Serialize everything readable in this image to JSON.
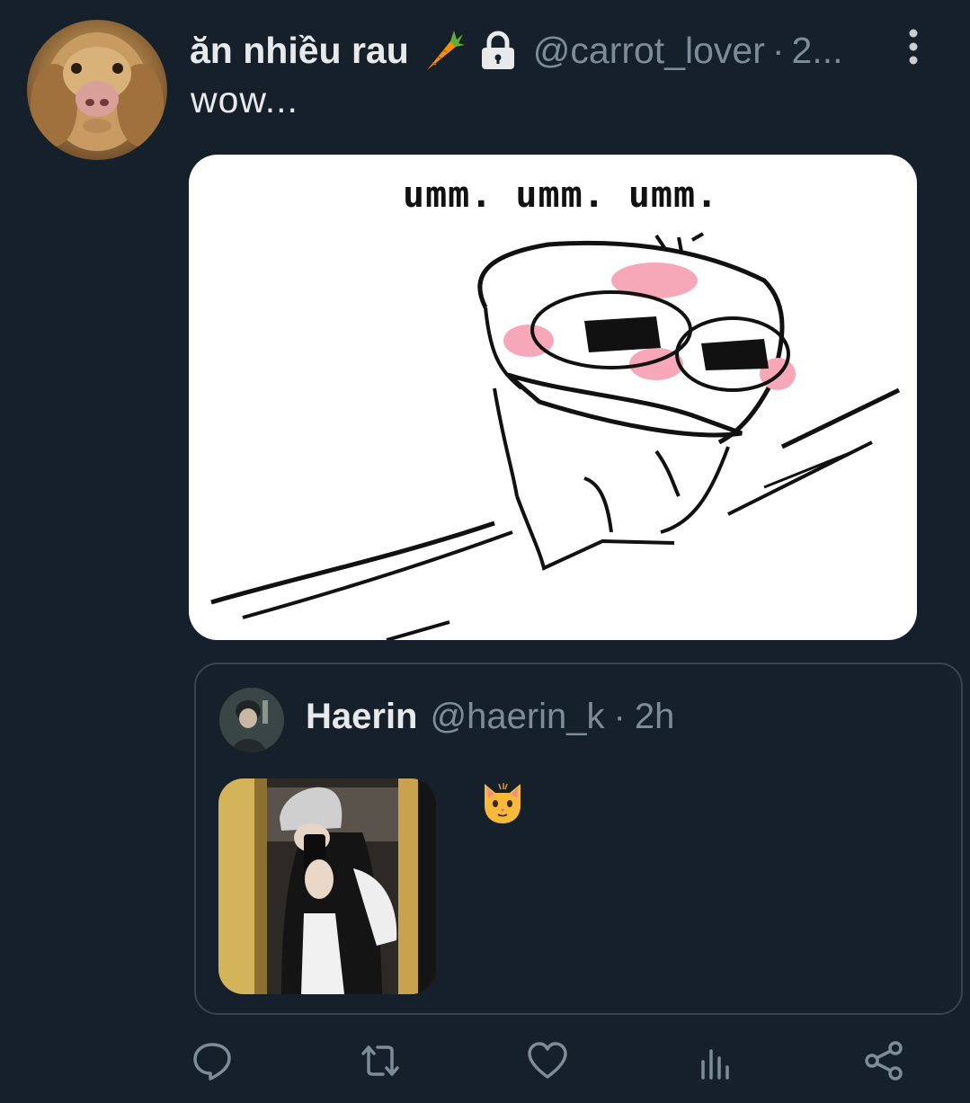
{
  "post": {
    "display_name": "ăn nhiều rau",
    "name_emoji": "carrot",
    "protected_icon": "lock-icon",
    "handle": "@carrot_lover",
    "separator": "·",
    "time": "2...",
    "text": "wow...",
    "more_icon": "more-vertical-icon",
    "media": {
      "caption": "umm. umm. umm.",
      "blush_color": "#f7a8b8"
    }
  },
  "quoted_post": {
    "display_name": "Haerin",
    "handle": "@haerin_k",
    "separator": "·",
    "time": "2h",
    "emoji": "cat-face"
  },
  "actions": [
    {
      "name": "reply",
      "icon": "reply-icon"
    },
    {
      "name": "retweet",
      "icon": "retweet-icon"
    },
    {
      "name": "like",
      "icon": "heart-icon"
    },
    {
      "name": "views",
      "icon": "analytics-icon"
    },
    {
      "name": "share",
      "icon": "share-icon"
    }
  ],
  "colors": {
    "background": "#16202b",
    "text_primary": "#e7e9ea",
    "text_secondary": "#7c8c99",
    "border": "#38444d"
  }
}
